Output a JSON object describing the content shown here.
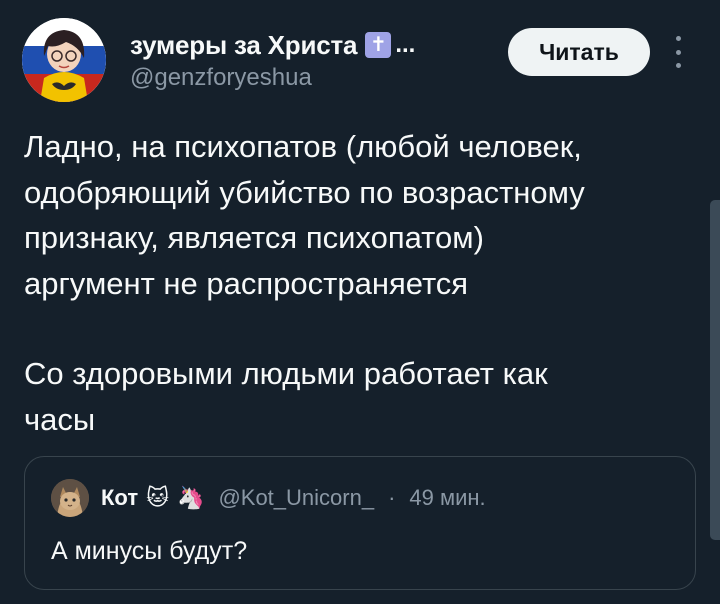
{
  "author": {
    "display_name": "зумеры за Христа",
    "badge": "✝",
    "truncation": "...",
    "handle": "@genzforyeshua"
  },
  "follow_button": {
    "label": "Читать"
  },
  "tweet": {
    "paragraphs": [
      "Ладно, на психопатов (любой человек,\nодобряющий убийство по возрастному\nпризнаку, является психопатом)\nаргумент не распространяется",
      "Со здоровыми людьми работает как\nчасы"
    ]
  },
  "quote": {
    "name": "Кот",
    "emojis": [
      "🐱",
      "🦄"
    ],
    "handle": "@Kot_Unicorn_",
    "separator": "·",
    "time": "49 мин.",
    "text": "А минусы будут?"
  },
  "colors": {
    "background": "#15202b",
    "text": "#f7f9f9",
    "secondary": "#8b98a5",
    "border": "#38444d",
    "button_bg": "#eff3f4"
  }
}
